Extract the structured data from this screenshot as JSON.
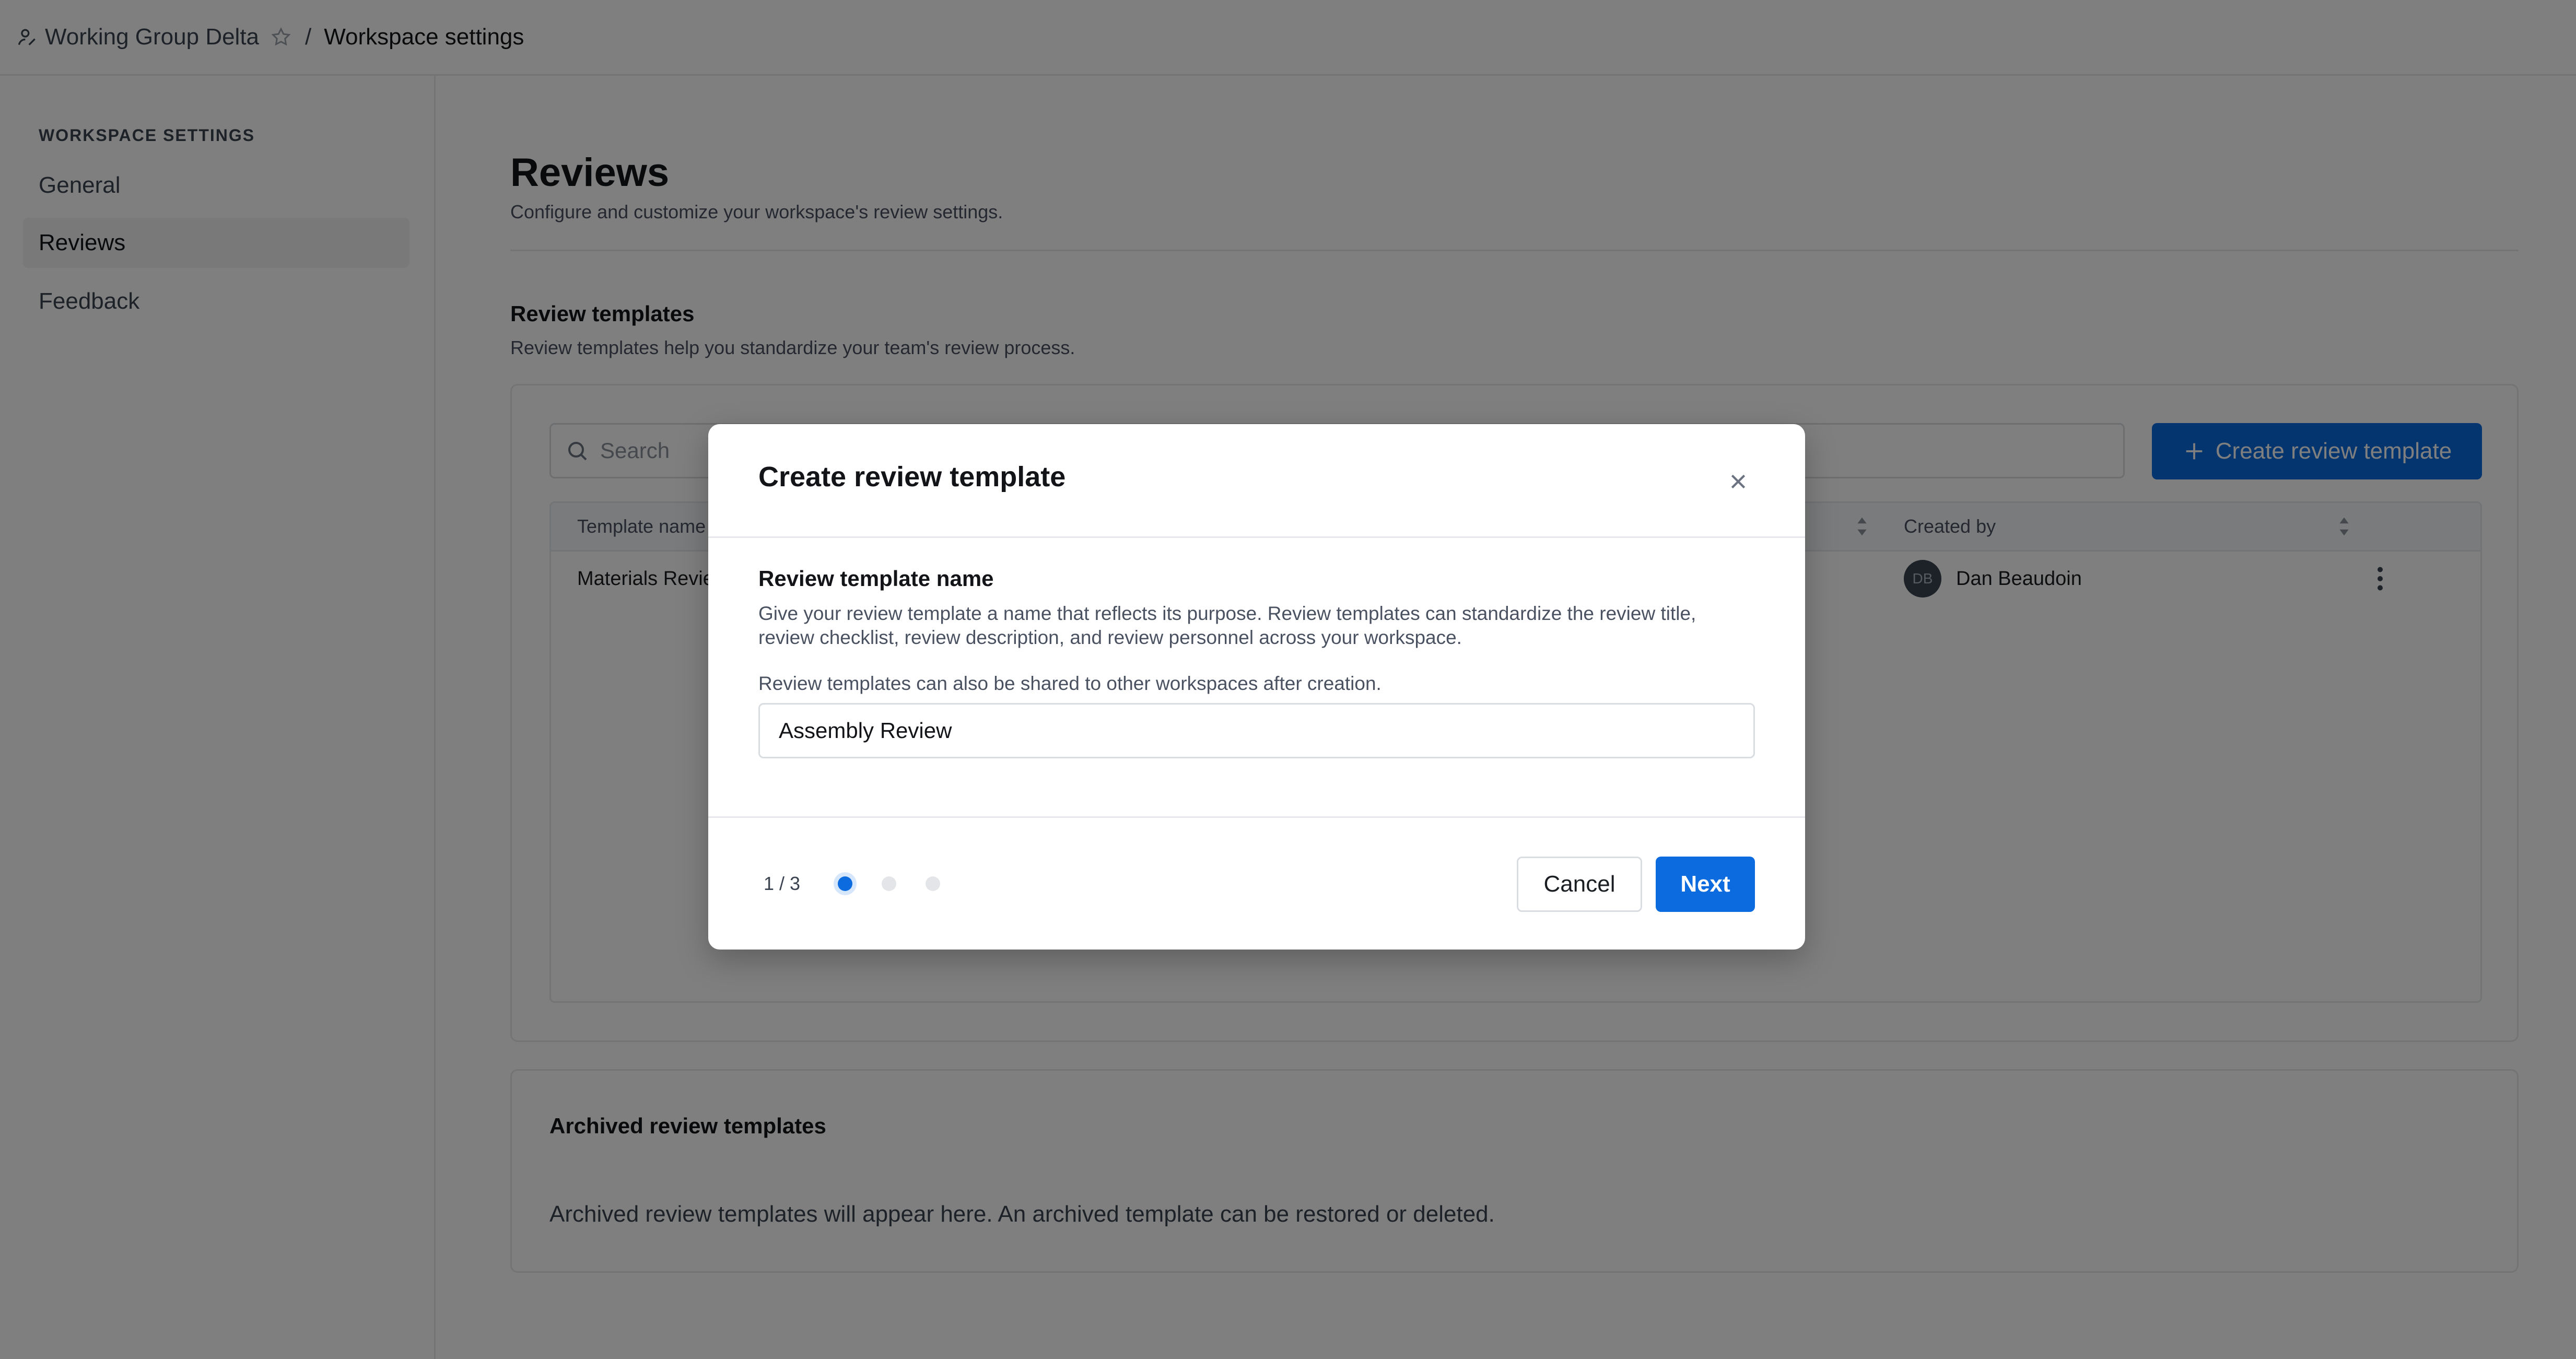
{
  "topbar": {
    "workspace_name": "Working Group Delta",
    "separator": "/",
    "current_page": "Workspace settings"
  },
  "sidebar": {
    "heading": "WORKSPACE SETTINGS",
    "items": [
      {
        "label": "General",
        "active": false
      },
      {
        "label": "Reviews",
        "active": true
      },
      {
        "label": "Feedback",
        "active": false
      }
    ]
  },
  "main": {
    "title": "Reviews",
    "subtitle": "Configure and customize your workspace's review settings.",
    "templates": {
      "title": "Review templates",
      "subtitle": "Review templates help you standardize your team's review process.",
      "search_placeholder": "Search",
      "create_button": "Create review template",
      "columns": [
        "Template name",
        "Created by"
      ],
      "rows": [
        {
          "name": "Materials Review",
          "creator_initials": "DB",
          "creator": "Dan Beaudoin"
        }
      ]
    },
    "archived": {
      "title": "Archived review templates",
      "empty_text": "Archived review templates will appear here. An archived template can be restored or deleted."
    }
  },
  "modal": {
    "title": "Create review template",
    "field_label": "Review template name",
    "help_text": "Give your review template a name that reflects its purpose. Review templates can standardize the review title, review checklist, review description, and review personnel across your workspace.",
    "help_text_2": "Review templates can also be shared to other workspaces after creation.",
    "input_value": "Assembly Review",
    "step_indicator": "1 / 3",
    "current_step": 1,
    "total_steps": 3,
    "cancel_label": "Cancel",
    "next_label": "Next"
  },
  "colors": {
    "primary": "#0b6bdf",
    "overlay": "rgba(0,0,0,0.5)",
    "border": "#e6e8eb"
  }
}
